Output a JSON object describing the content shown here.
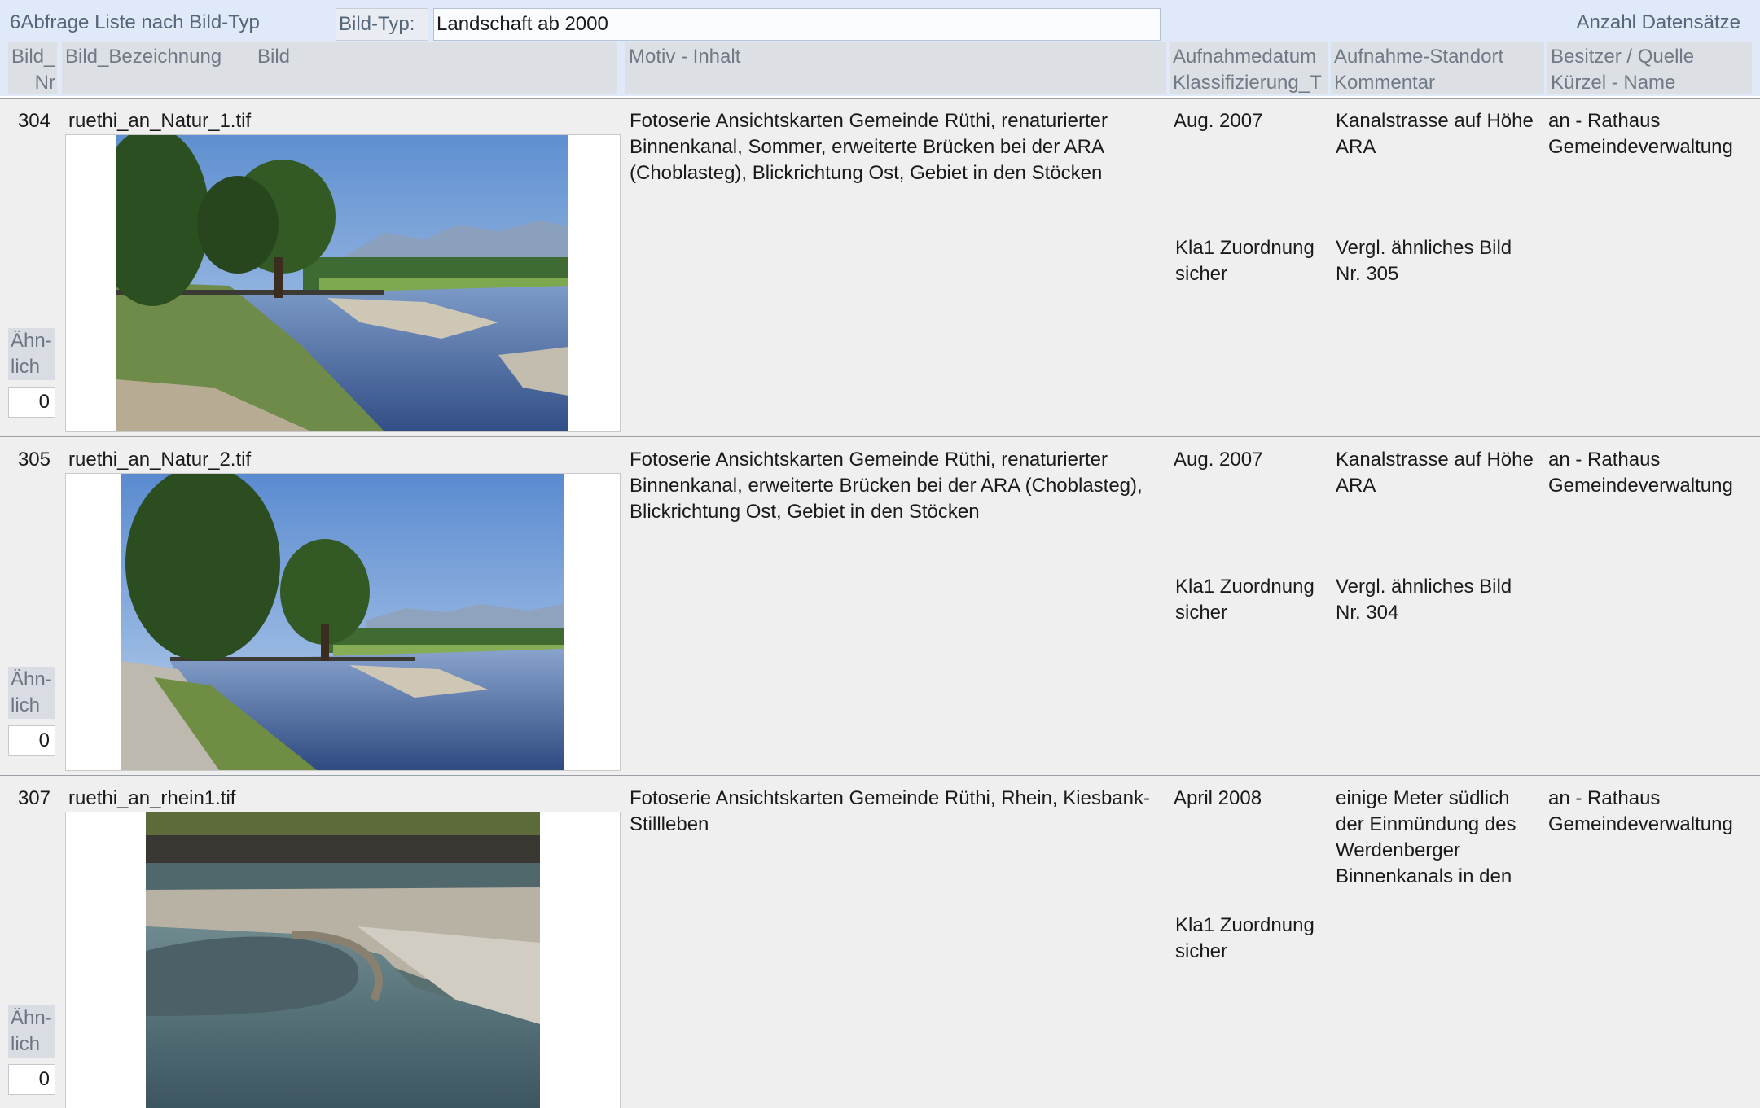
{
  "form": {
    "title": "6Abfrage Liste nach Bild-Typ",
    "bildtyp_label": "Bild-Typ:",
    "bildtyp_value": "Landschaft ab 2000",
    "count_label": "Anzahl Datensätze"
  },
  "columns": {
    "nr_line1": "Bild_",
    "nr_line2": "Nr",
    "bezeichnung": "Bild_Bezeichnung",
    "bild": "Bild",
    "motiv": "Motiv - Inhalt",
    "datum_line1": "Aufnahmedatum",
    "datum_line2": "Klassifizierung_T",
    "standort_line1": "Aufnahme-Standort",
    "standort_line2": "Kommentar",
    "besitzer_line1": "Besitzer / Quelle",
    "besitzer_line2": "Kürzel - Name"
  },
  "records": [
    {
      "nr": "304",
      "name": "ruethi_an_Natur_1.tif",
      "motiv": "Fotoserie Ansichtskarten Gemeinde Rüthi, renaturierter Binnenkanal, Sommer, erweiterte Brücken bei der ARA (Choblasteg), Blickrichtung Ost, Gebiet in den Stöcken",
      "datum": "Aug. 2007",
      "klassifizierung": "Kla1 Zuordnung sicher",
      "standort": "Kanalstrasse auf Höhe ARA",
      "kommentar": "Vergl. ähnliches Bild Nr. 305",
      "besitzer": "an - Rathaus Gemeindeverwaltung",
      "aehnlich_label": "Ähn-lich",
      "aehnlich_count": "0"
    },
    {
      "nr": "305",
      "name": "ruethi_an_Natur_2.tif",
      "motiv": "Fotoserie Ansichtskarten Gemeinde Rüthi, renaturierter Binnenkanal, erweiterte Brücken bei der ARA (Choblasteg), Blickrichtung Ost, Gebiet in den Stöcken",
      "datum": "Aug. 2007",
      "klassifizierung": "Kla1 Zuordnung sicher",
      "standort": "Kanalstrasse auf Höhe ARA",
      "kommentar": "Vergl. ähnliches Bild Nr. 304",
      "besitzer": "an - Rathaus Gemeindeverwaltung",
      "aehnlich_label": "Ähn-lich",
      "aehnlich_count": "0"
    },
    {
      "nr": "307",
      "name": "ruethi_an_rhein1.tif",
      "motiv": "Fotoserie Ansichtskarten Gemeinde Rüthi, Rhein, Kiesbank-Stillleben",
      "datum": "April 2008",
      "klassifizierung": "Kla1 Zuordnung sicher",
      "standort": "einige Meter südlich der Einmündung des Werdenberger Binnenkanals in den",
      "kommentar": "",
      "besitzer": "an - Rathaus Gemeindeverwaltung",
      "aehnlich_label": "Ähn-lich",
      "aehnlich_count": "0"
    }
  ]
}
